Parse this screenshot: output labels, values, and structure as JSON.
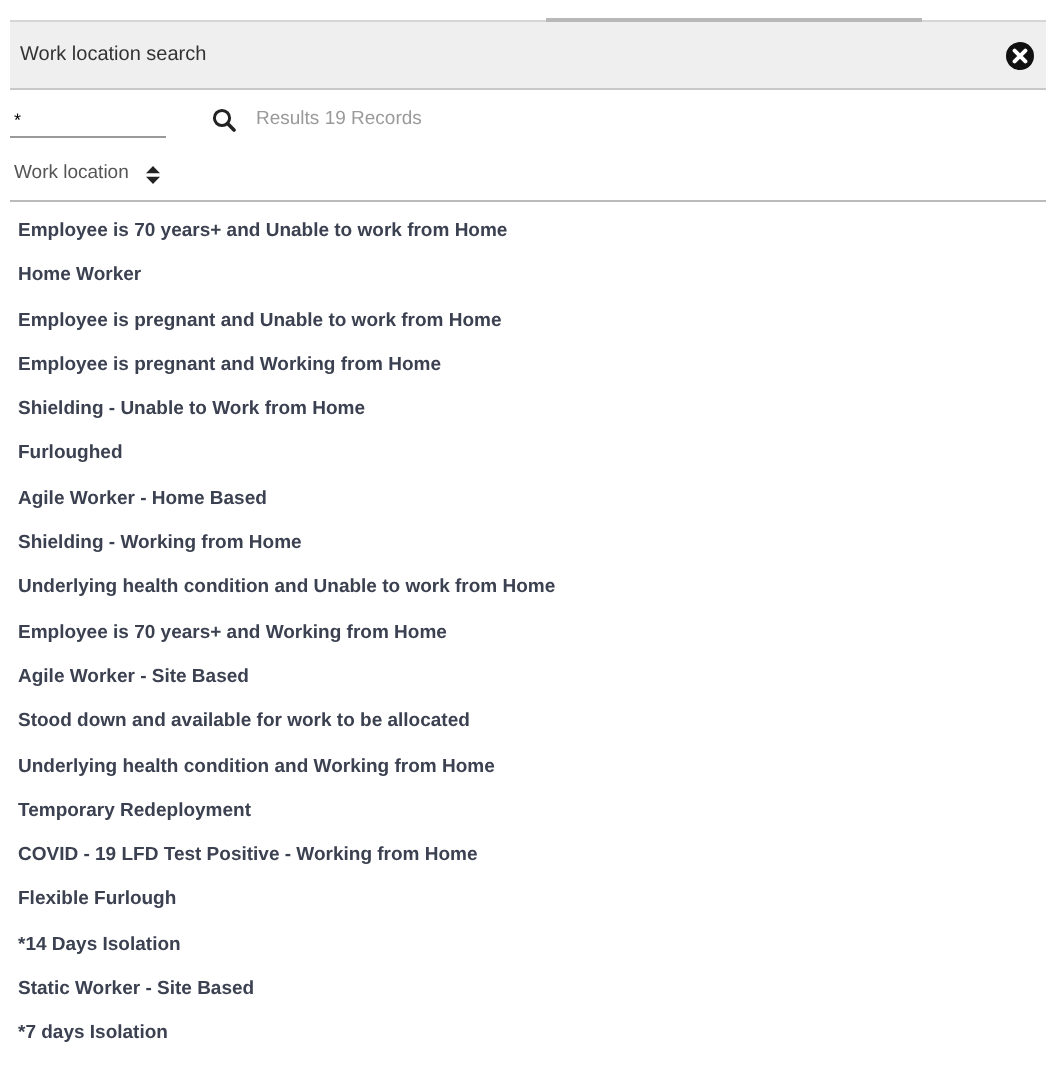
{
  "dialog": {
    "title": "Work location search"
  },
  "search": {
    "value": "*",
    "results": "Results 19 Records"
  },
  "column": {
    "label": "Work location"
  },
  "rows": [
    {
      "label": "Employee is 70 years+ and Unable to work from Home"
    },
    {
      "label": "Home Worker"
    },
    {
      "label": "Employee is pregnant and Unable to work from Home"
    },
    {
      "label": "Employee is pregnant and Working from Home"
    },
    {
      "label": "Shielding - Unable to Work from Home"
    },
    {
      "label": "Furloughed"
    },
    {
      "label": "Agile Worker - Home Based"
    },
    {
      "label": "Shielding - Working from Home"
    },
    {
      "label": "Underlying health condition and Unable to work from Home"
    },
    {
      "label": "Employee is 70 years+ and Working from Home"
    },
    {
      "label": "Agile Worker - Site Based"
    },
    {
      "label": "Stood down and available for work to be allocated"
    },
    {
      "label": "Underlying health condition and Working from Home"
    },
    {
      "label": "Temporary Redeployment"
    },
    {
      "label": "COVID - 19 LFD Test Positive - Working from Home"
    },
    {
      "label": "Flexible Furlough"
    },
    {
      "label": "*14 Days Isolation"
    },
    {
      "label": "Static Worker - Site Based"
    },
    {
      "label": "*7 days Isolation"
    }
  ]
}
